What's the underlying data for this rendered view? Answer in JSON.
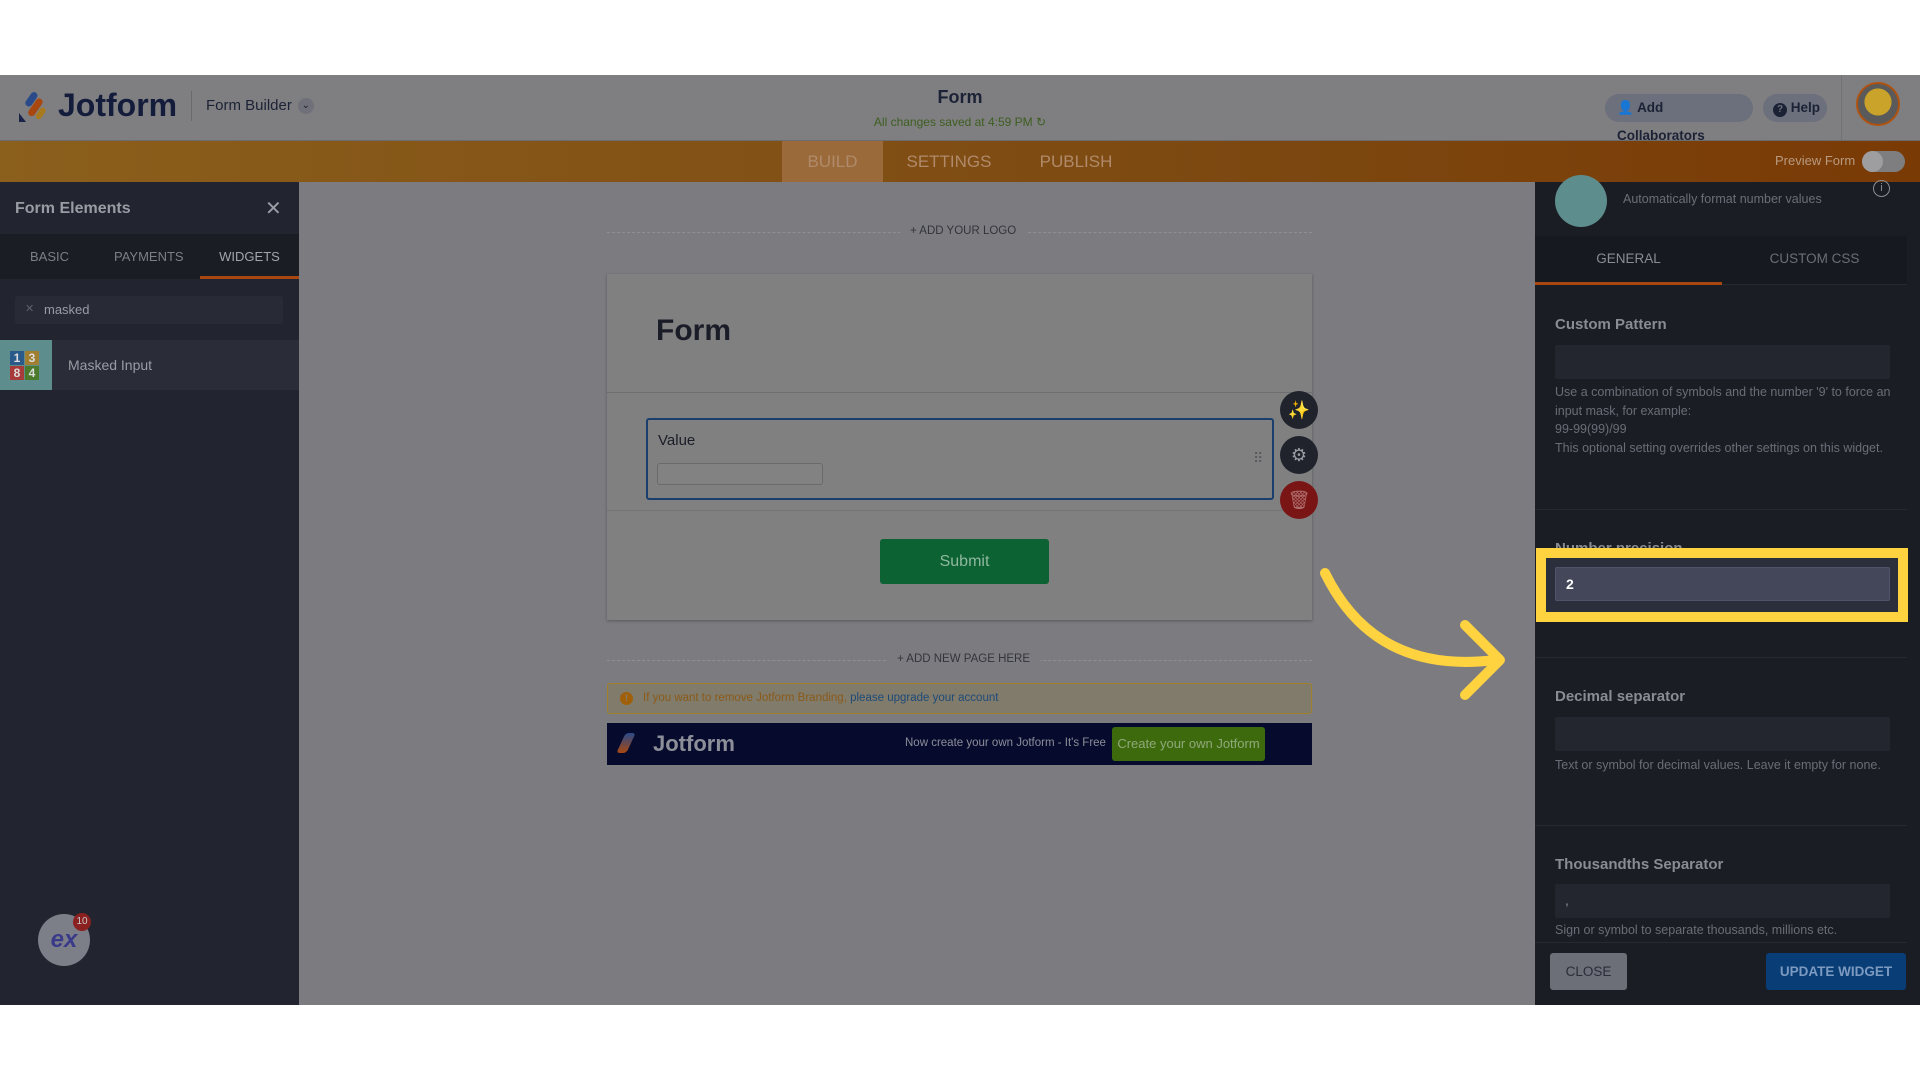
{
  "header": {
    "logo_text": "Jotform",
    "builder_label": "Form Builder",
    "form_title": "Form",
    "save_status": "All changes saved at 4:59 PM",
    "add_collaborators": "Add Collaborators",
    "help": "Help"
  },
  "nav": {
    "tabs": [
      {
        "label": "BUILD",
        "active": true
      },
      {
        "label": "SETTINGS"
      },
      {
        "label": "PUBLISH"
      }
    ],
    "preview_label": "Preview Form",
    "preview_on": false
  },
  "left_panel": {
    "title": "Form Elements",
    "tabs": [
      {
        "label": "BASIC"
      },
      {
        "label": "PAYMENTS"
      },
      {
        "label": "WIDGETS",
        "active": true
      }
    ],
    "search_value": "masked",
    "items": [
      {
        "label": "Masked Input",
        "icon": "number-tiles-icon"
      }
    ],
    "badge_count": "10"
  },
  "canvas": {
    "add_logo": "+ ADD YOUR LOGO",
    "form_heading": "Form",
    "field_label": "Value",
    "submit": "Submit",
    "add_page": "+ ADD NEW PAGE HERE",
    "branding_text": "If you want to remove Jotform Branding, ",
    "branding_link": "please upgrade your account",
    "banner_logo": "Jotform",
    "banner_text": "Now create your own Jotform - It's Free",
    "banner_button": "Create your own Jotform"
  },
  "right_panel": {
    "subtitle": "Automatically format number values",
    "tabs": [
      {
        "label": "GENERAL",
        "active": true
      },
      {
        "label": "CUSTOM CSS"
      }
    ],
    "custom_pattern": {
      "label": "Custom Pattern",
      "value": "",
      "help": [
        "Use a combination of symbols and the number '9' to force an input mask, for example:",
        "99-99(99)/99",
        "This optional setting overrides other settings on this widget."
      ]
    },
    "number_precision": {
      "label": "Number precision",
      "value": "2"
    },
    "decimal_separator": {
      "label": "Decimal separator",
      "value": "",
      "help": "Text or symbol for decimal values. Leave it empty for none."
    },
    "thousandths_separator": {
      "label": "Thousandths Separator",
      "value": ",",
      "help": "Sign or symbol to separate thousands, millions etc."
    },
    "close": "CLOSE",
    "update": "UPDATE WIDGET"
  },
  "colors": {
    "accent_orange": "#c2560a",
    "highlight": "#ffd23f",
    "submit_green": "#0d6233",
    "update_blue": "#083d75"
  }
}
